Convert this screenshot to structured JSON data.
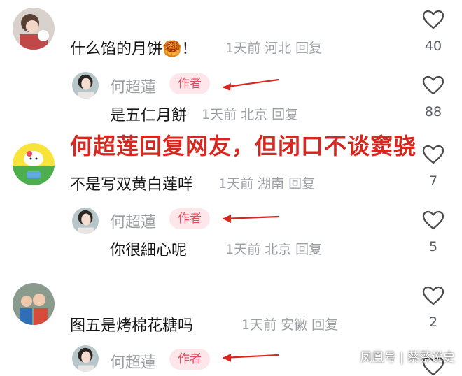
{
  "comments": [
    {
      "type": "comment",
      "text": "什么馅的月饼🥮！",
      "meta": "1天前 河北 回复",
      "likes": "40"
    },
    {
      "type": "reply",
      "name": "何超蓮",
      "badge": "作者",
      "text": "是五仁月餅",
      "meta": "1天前 北京 回复",
      "likes": "88"
    },
    {
      "type": "comment",
      "text": "不是写双黄白莲咩",
      "meta": "1天前 湖南 回复",
      "likes": "7"
    },
    {
      "type": "reply",
      "name": "何超蓮",
      "badge": "作者",
      "text": "你很細心呢",
      "meta": "1天前 北京 回复",
      "likes": "5"
    },
    {
      "type": "comment",
      "text": "图五是烤棉花糖吗",
      "meta": "1天前 安徽 回复",
      "likes": "2"
    },
    {
      "type": "reply",
      "name": "何超蓮",
      "badge": "作者"
    }
  ],
  "overlay_caption": "何超莲回复网友，但闭口不谈窦骁",
  "watermark": "凤凰号 | 蔡蔡说史",
  "colors": {
    "badge_bg": "#fde7ea",
    "badge_text": "#e8475f",
    "arrow": "#d7271f",
    "caption": "#d7271f"
  }
}
